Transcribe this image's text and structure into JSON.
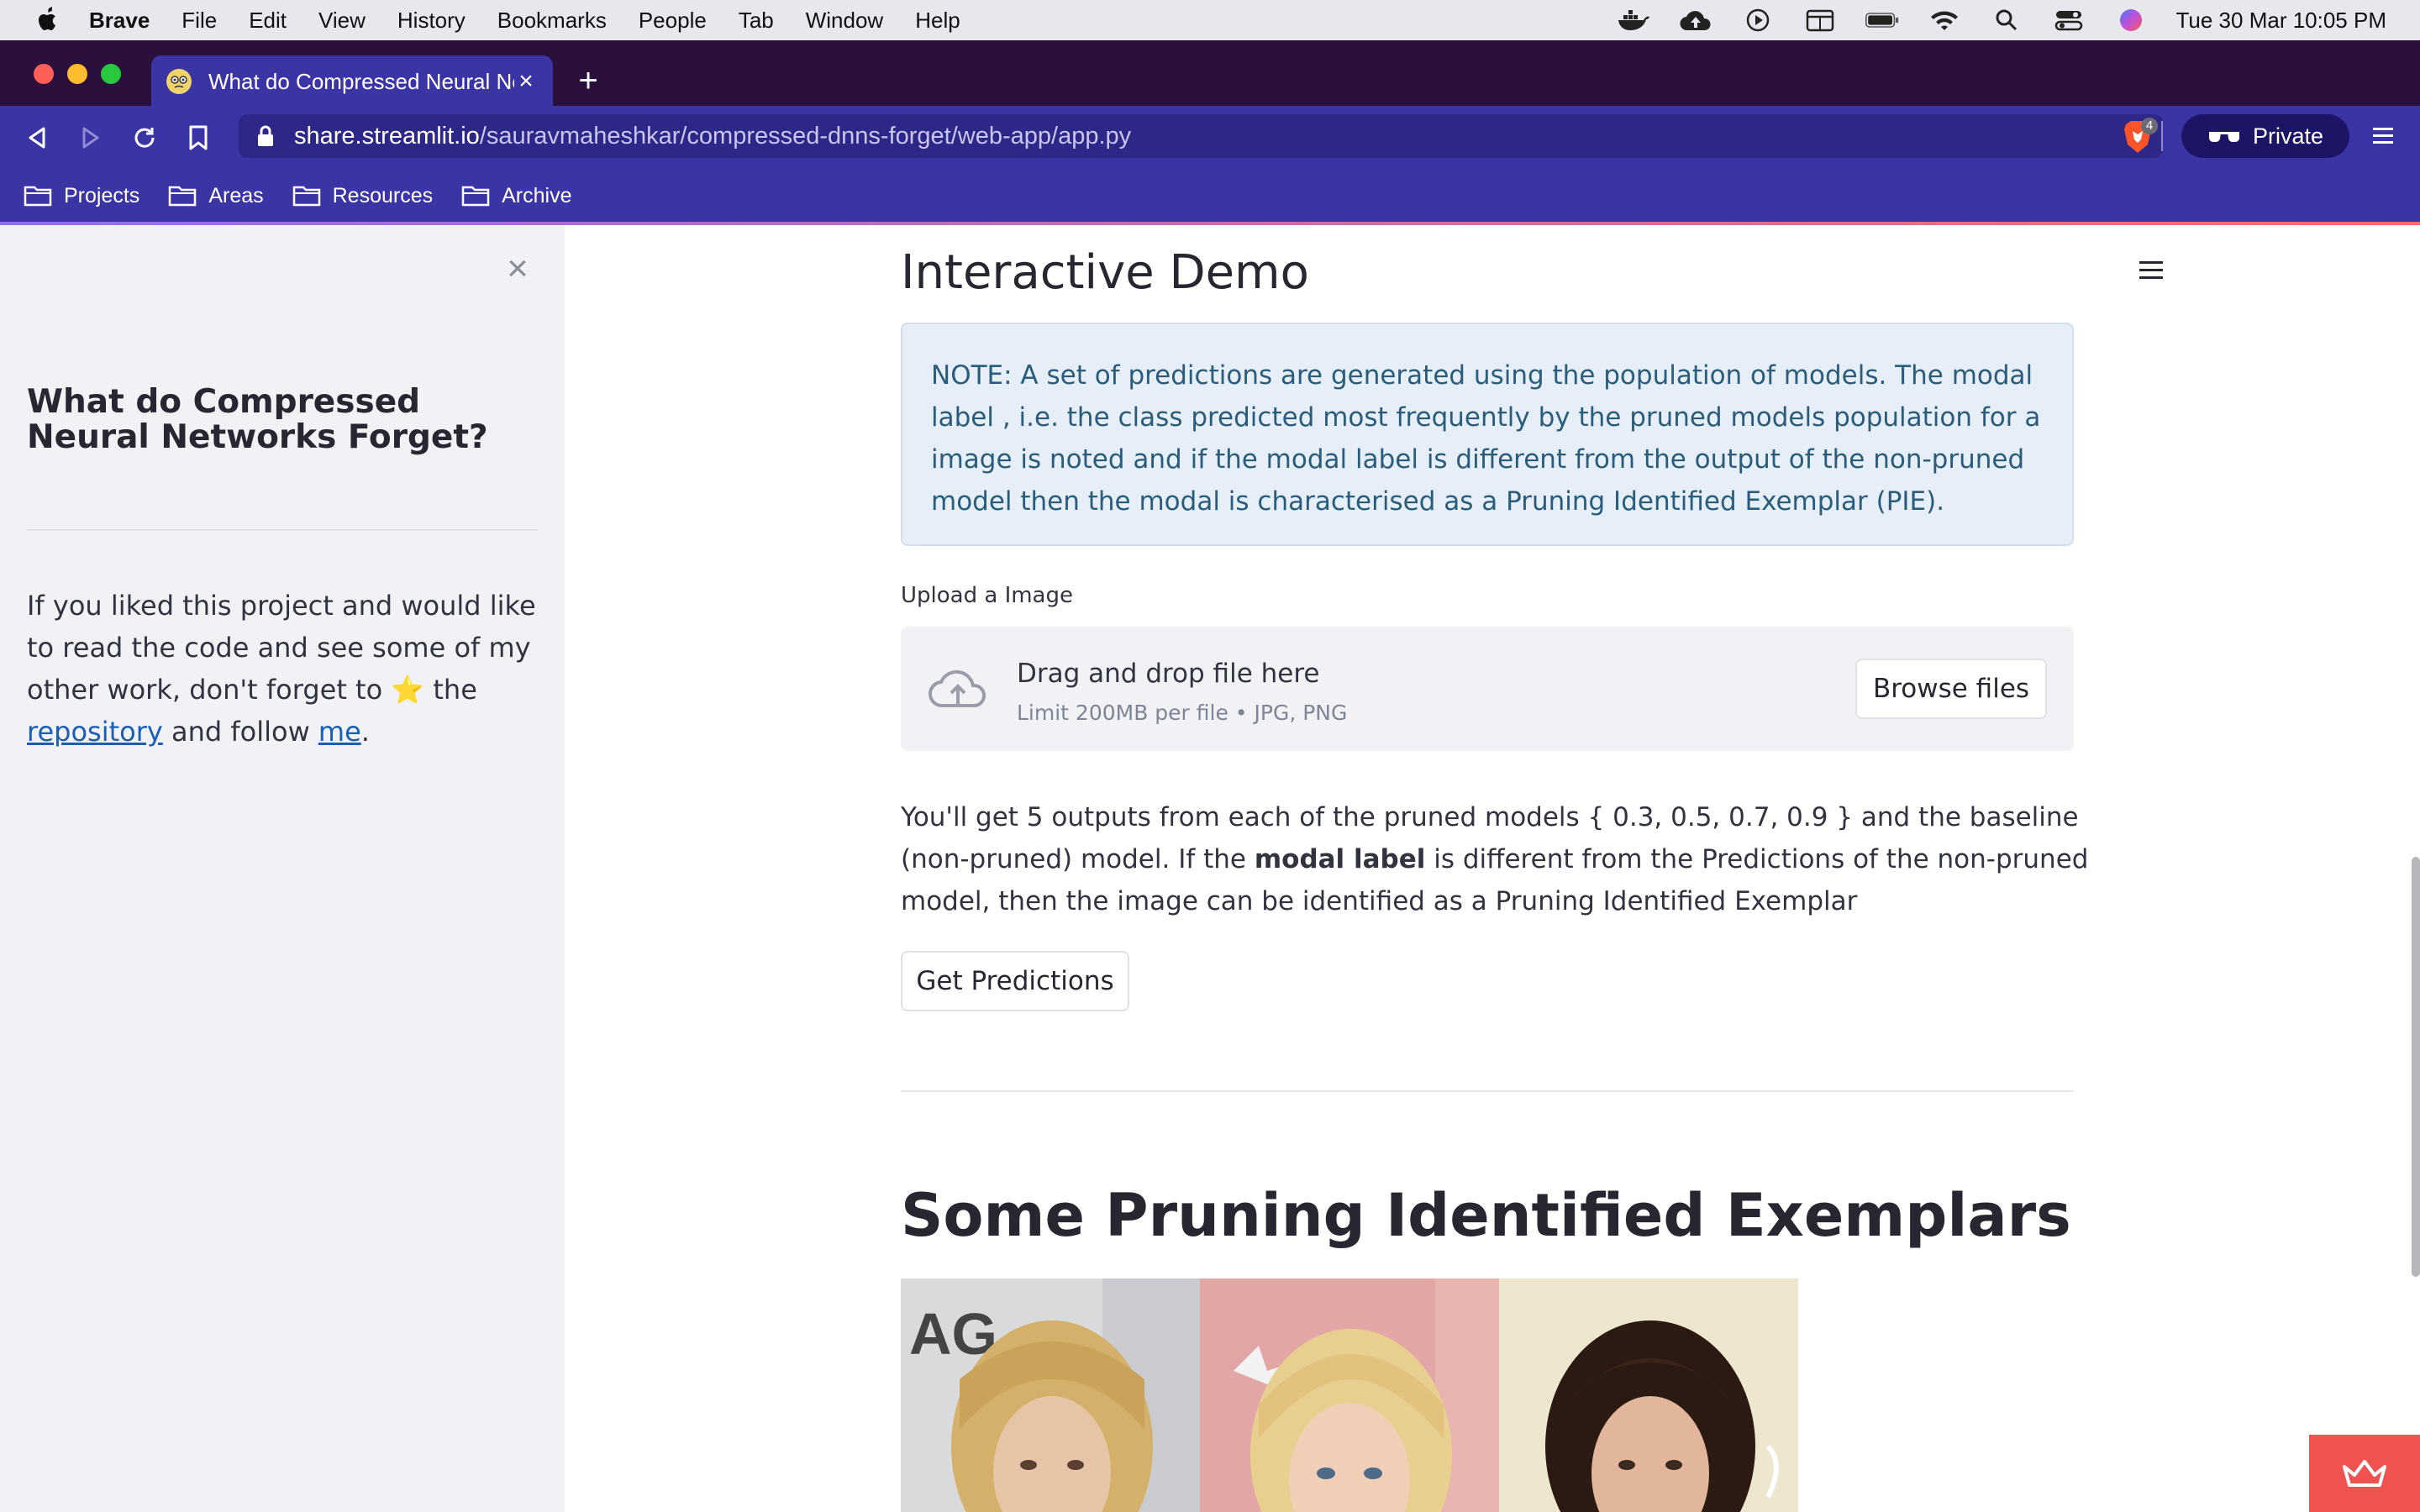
{
  "menubar": {
    "app_name": "Brave",
    "items": [
      "File",
      "Edit",
      "View",
      "History",
      "Bookmarks",
      "People",
      "Tab",
      "Window",
      "Help"
    ],
    "datetime": "Tue 30 Mar  10:05 PM"
  },
  "browser": {
    "tab_title": "What do Compressed Neural Ne",
    "url_host": "share.streamlit.io",
    "url_path": "/sauravmaheshkar/compressed-dnns-forget/web-app/app.py",
    "shield_count": "4",
    "private_label": "Private",
    "bookmarks": [
      "Projects",
      "Areas",
      "Resources",
      "Archive"
    ]
  },
  "sidebar": {
    "title": "What do Compressed Neural Networks Forget?",
    "text_before_star": "If you liked this project and would like to read the code and see some of my other work, don't forget to ",
    "star": "⭐",
    "text_the": " the ",
    "repo_link": "repository",
    "text_and_follow": " and follow ",
    "me_link": "me",
    "period": "."
  },
  "main": {
    "heading": "Interactive Demo",
    "note": "NOTE: A set of predictions are generated using the population of models. The modal label , i.e. the class predicted most frequently by the pruned models population for a image is noted and if the modal label is different from the output of the non-pruned model then the modal is characterised as a Pruning Identified Exemplar (PIE).",
    "upload_label": "Upload a Image",
    "drop_main": "Drag and drop file here",
    "drop_sub": "Limit 200MB per file • JPG, PNG",
    "browse_button": "Browse files",
    "desc_part1": "You'll get 5 outputs from each of the pruned models { 0.3, 0.5, 0.7, 0.9 } and the baseline (non-pruned) model. If the ",
    "desc_bold": "modal label",
    "desc_part2": " is different from the Predictions of the non-pruned model, then the image can be identified as a Pruning Identified Exemplar",
    "predict_button": "Get Predictions",
    "pie_heading": "Some Pruning Identified Exemplars"
  },
  "colors": {
    "brave_tabstrip": "#2b0f3c",
    "brave_toolbar": "#3a34a5",
    "sidebar_bg": "#f0f2f6",
    "note_bg": "#e6eef8",
    "note_text": "#2b5c7a",
    "link": "#1a5fb4",
    "streamlit_red": "#ef5350"
  },
  "icons": [
    "apple-icon",
    "docker-icon",
    "cloud-upload-icon",
    "play-icon",
    "calendar-icon",
    "battery-icon",
    "wifi-icon",
    "search-icon",
    "control-center-icon",
    "siri-icon",
    "back-icon",
    "forward-icon",
    "reload-icon",
    "bookmark-icon",
    "lock-icon",
    "brave-shield-icon",
    "private-glasses-icon",
    "menu-icon",
    "folder-icon",
    "close-icon",
    "upload-cloud-icon",
    "streamlit-crown-icon"
  ]
}
